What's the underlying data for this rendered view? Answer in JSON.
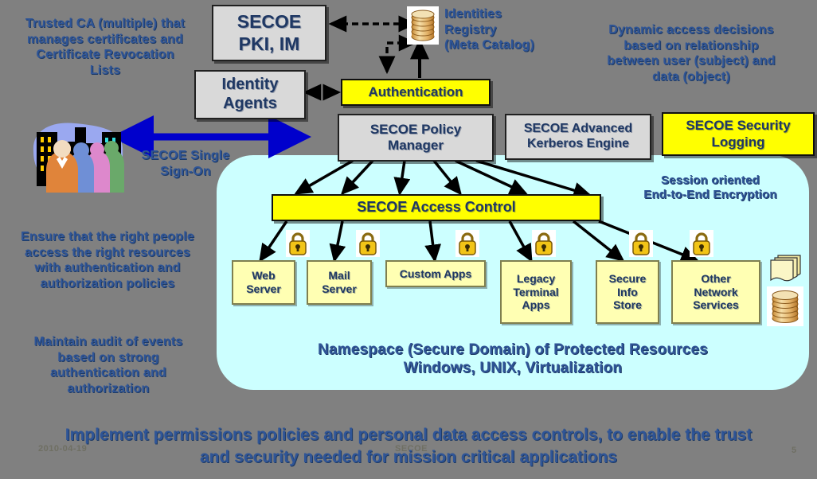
{
  "slide": {
    "background_color": "#808080",
    "domain_region_color": "#ccffff",
    "accent_yellow": "#ffff00",
    "accent_light_yellow": "#ffffb3",
    "text_blue": "#2f5597",
    "box_blue_text": "#1f3864",
    "arrow_blue": "#0000cc"
  },
  "captions": {
    "trusted_ca": "Trusted CA (multiple) that\nmanages certificates and\nCertificate Revocation\nLists",
    "identities_registry": "Identities\nRegistry\n(Meta Catalog)",
    "dynamic_access": "Dynamic access decisions\nbased on relationship\nbetween user (subject) and\ndata (object)",
    "single_sign_on": "SECOE Single\nSign-On",
    "ensure_right_people": "Ensure that the right people\naccess the right resources\nwith authentication and\nauthorization  policies",
    "maintain_audit": "Maintain audit of events\nbased on strong\nauthentication and\nauthorization",
    "session_encryption": "Session oriented\nEnd-to-End  Encryption",
    "namespace": "Namespace (Secure Domain) of Protected Resources\nWindows, UNIX, Virtualization",
    "bottom_statement": "Implement permissions policies and personal data access controls, to enable the trust\nand security needed for mission critical applications"
  },
  "components": {
    "pki_im": "SECOE\nPKI, IM",
    "identity_agents": "Identity\nAgents",
    "authentication": "Authentication",
    "policy_manager": "SECOE Policy\nManager",
    "kerberos_engine": "SECOE Advanced\nKerberos Engine",
    "security_logging": "SECOE Security\nLogging",
    "access_control": "SECOE Access Control"
  },
  "resources": [
    {
      "label": "Web\nServer",
      "name": "web-server"
    },
    {
      "label": "Mail\nServer",
      "name": "mail-server"
    },
    {
      "label": "Custom Apps",
      "name": "custom-apps"
    },
    {
      "label": "Legacy\nTerminal\nApps",
      "name": "legacy-terminal-apps"
    },
    {
      "label": "Secure\nInfo\nStore",
      "name": "secure-info-store"
    },
    {
      "label": "Other\nNetwork\nServices",
      "name": "other-network-services"
    }
  ],
  "icons": {
    "padlock": "padlock-icon",
    "database": "database-cylinder-icon",
    "documents": "stacked-documents-icon",
    "people_city": "people-and-city-clipart"
  },
  "footer": {
    "date": "2010-04-19",
    "center": "SECOE",
    "page_number": "5"
  }
}
